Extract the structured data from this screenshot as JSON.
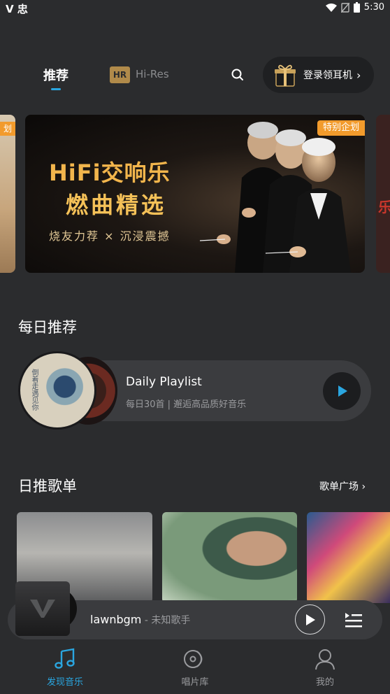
{
  "status_bar": {
    "left_glyphs": "V 忠",
    "time": "5:30"
  },
  "top_nav": {
    "tab_recommend": "推荐",
    "hires_badge": "HR",
    "tab_hires": "Hi-Res",
    "gift_label": "登录领耳机",
    "gift_chevron": "›"
  },
  "banner": {
    "side_left_tag": "划",
    "side_right_char": "乐",
    "tag": "特别企划",
    "title_line1": "HiFi交响乐",
    "title_line2": "燃曲精选",
    "subtitle": "烧友力荐 × 沉浸震撼"
  },
  "daily": {
    "section_title": "每日推荐",
    "cover_text": "倒着走遇见你",
    "playlist_name": "Daily Playlist",
    "description": "每日30首 | 邂逅高品质好音乐"
  },
  "playlists": {
    "section_title": "日推歌单",
    "more_label": "歌单广场 ›"
  },
  "player": {
    "song": "lawnbgm",
    "artist": " - 未知歌手"
  },
  "bottom_nav": {
    "discover": "发现音乐",
    "library": "唱片库",
    "mine": "我的"
  },
  "colors": {
    "accent": "#2aa6e0",
    "banner_tag": "#f29b2c",
    "banner_title": "#f2b54c",
    "background": "#2b2c2e"
  }
}
